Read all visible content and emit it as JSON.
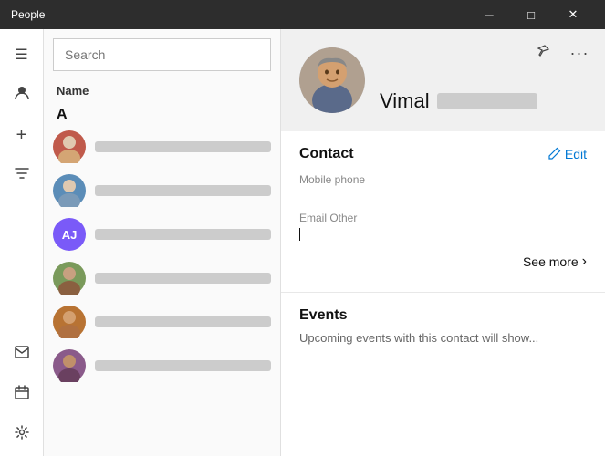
{
  "titlebar": {
    "title": "People",
    "minimize_label": "─",
    "maximize_label": "□",
    "close_label": "✕"
  },
  "icon_sidebar": {
    "menu_icon": "☰",
    "person_icon": "👤",
    "add_icon": "+",
    "filter_icon": "⊟",
    "mail_icon": "✉",
    "calendar_icon": "📅",
    "settings_icon": "⚙"
  },
  "contact_list": {
    "search_placeholder": "Search",
    "name_header": "Name",
    "alpha_group": "A",
    "contacts": [
      {
        "id": 1,
        "initials": "",
        "has_photo": true,
        "color": "av-1"
      },
      {
        "id": 2,
        "initials": "",
        "has_photo": true,
        "color": "av-2"
      },
      {
        "id": 3,
        "initials": "AJ",
        "has_photo": false,
        "color": "av-initials-aj"
      },
      {
        "id": 4,
        "initials": "",
        "has_photo": true,
        "color": "av-3"
      },
      {
        "id": 5,
        "initials": "",
        "has_photo": true,
        "color": "av-4"
      },
      {
        "id": 6,
        "initials": "",
        "has_photo": true,
        "color": "av-5"
      }
    ]
  },
  "detail": {
    "contact_name_prefix": "Vimal",
    "pin_icon": "📌",
    "more_icon": "•••",
    "contact_section_title": "Contact",
    "edit_label": "Edit",
    "edit_icon": "✏",
    "mobile_phone_label": "Mobile phone",
    "mobile_phone_value": "",
    "email_other_label": "Email Other",
    "email_other_value": "",
    "see_more_label": "See more",
    "chevron_right": "›",
    "events_title": "Events",
    "events_description": "Upcoming events with this contact will show..."
  }
}
